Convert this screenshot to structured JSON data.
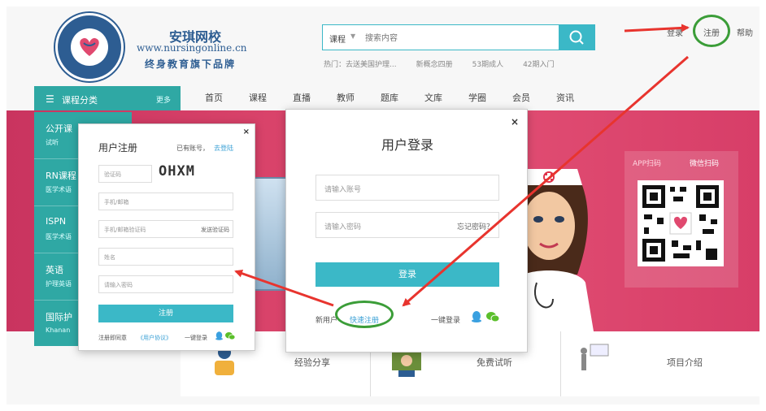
{
  "header": {
    "brand_cn": "安琪网校",
    "brand_url": "www.nursingonline.cn",
    "slogan": "终身教育旗下品牌",
    "search": {
      "category": "课程",
      "placeholder": "搜索内容"
    },
    "hot_label": "热门：",
    "hot_items": [
      "去送美国护理...",
      "新概念四册",
      "53期成人",
      "42期入门"
    ],
    "top_links": {
      "login": "登录",
      "register": "注册",
      "help": "帮助"
    }
  },
  "nav": {
    "category_label": "课程分类",
    "category_more": "更多",
    "items": [
      "首页",
      "课程",
      "直播",
      "教师",
      "题库",
      "文库",
      "学圈",
      "会员",
      "资讯"
    ]
  },
  "sidebar": {
    "items": [
      {
        "title": "公开课",
        "sub": "试听"
      },
      {
        "title": "RN课程",
        "sub": "医学术语"
      },
      {
        "title": "ISPN",
        "sub": "医学术语"
      },
      {
        "title": "英语",
        "sub": "护理英语"
      },
      {
        "title": "国际护",
        "sub": "Khanan"
      }
    ]
  },
  "qr": {
    "app_label": "APP扫码",
    "wechat_label": "微信扫码"
  },
  "features": [
    {
      "label": "经验分享",
      "icon": "experience-icon"
    },
    {
      "label": "免费试听",
      "icon": "free-trial-icon"
    },
    {
      "label": "项目介绍",
      "icon": "project-intro-icon"
    }
  ],
  "login_modal": {
    "title": "用户登录",
    "account_placeholder": "请输入账号",
    "password_placeholder": "请输入密码",
    "forgot": "忘记密码？",
    "login_button": "登录",
    "new_user": "新用户",
    "quick_register": "快速注册",
    "one_key_login": "一键登录"
  },
  "register_modal": {
    "title": "用户注册",
    "has_account": "已有账号，",
    "go_login": "去登陆",
    "captcha_placeholder": "验证码",
    "captcha_text": "OHXM",
    "phone_placeholder": "手机/邮箱",
    "code_placeholder": "手机/邮箱验证码",
    "send_code": "发送验证码",
    "name_placeholder": "姓名",
    "password_placeholder": "请输入密码",
    "register_button": "注册",
    "agree": "注册即同意",
    "protocol": "《用户协议》",
    "one_key_login": "一键登录"
  },
  "colors": {
    "teal": "#3bb8c7",
    "sidebar": "#2fa8a4",
    "banner": "#d9436a",
    "brand_blue": "#2d5d92",
    "highlight_circle": "#3b9d38",
    "arrow": "#e8342e"
  }
}
